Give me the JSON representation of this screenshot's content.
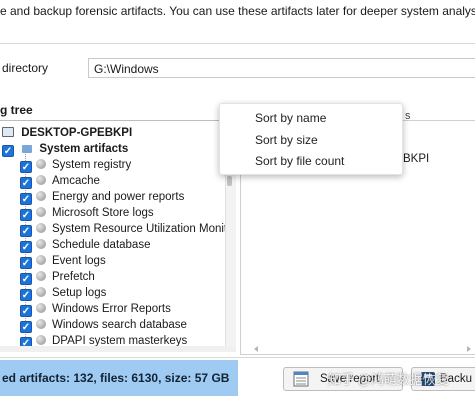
{
  "header": {
    "description": "e and backup forensic artifacts. You can use these artifacts later for deeper system analysis."
  },
  "directory": {
    "label": "directory",
    "value": "G:\\Windows"
  },
  "tree": {
    "title": "g tree",
    "root": "DESKTOP-GPEBKPI",
    "group": "System artifacts",
    "items": [
      "System registry",
      "Amcache",
      "Energy and power reports",
      "Microsoft Store logs",
      "System Resource Utilization Monito",
      "Schedule database",
      "Event logs",
      "Prefetch",
      "Setup logs",
      "Windows Error Reports",
      "Windows search database",
      "DPAPI system masterkeys"
    ]
  },
  "context_menu": {
    "items": [
      "Sort by name",
      "Sort by size",
      "Sort by file count"
    ]
  },
  "right_panel": {
    "hostname_tail": "BKPI",
    "top_text": "s"
  },
  "status": {
    "text": "ed artifacts: 132, files: 6130, size: 57 GB"
  },
  "buttons": {
    "save_report": "Save report",
    "backup": "Backu"
  },
  "watermark": "知乎 @鸿萌数据恢复"
}
